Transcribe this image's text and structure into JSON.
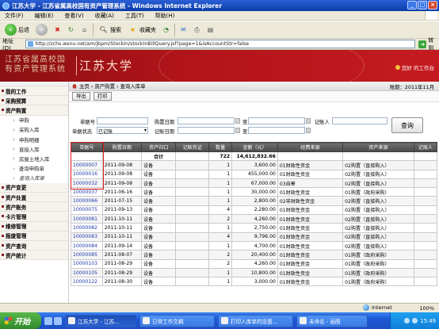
{
  "window": {
    "title": "江苏大学 - 江苏省属高校国有资产管理系统 - Windows Internet Explorer"
  },
  "menu": [
    "文件(F)",
    "编辑(E)",
    "查看(V)",
    "收藏(A)",
    "工具(T)",
    "帮助(H)"
  ],
  "toolbar": {
    "back": "后退",
    "search": "搜索",
    "favorites": "收藏夹"
  },
  "address": {
    "label": "地址(D)",
    "url": "http://zchs.wsnu.net/am/jbpm/StockIn/stockInBillQuery.jsf?page=1&isAccountStr=false",
    "go": "转到"
  },
  "banner": {
    "system_title_line1": "江苏省属高校国",
    "system_title_line2": "有资产管理系统",
    "university": "江苏大学",
    "user_text": "您好 的工作台"
  },
  "breadcrumb": {
    "text": "主页 › 资产购置 › 查询入库单",
    "period": "账期：2011年11月"
  },
  "actions": {
    "export": "导出",
    "print": "打印"
  },
  "filters": {
    "bill_no_label": "单据号",
    "buy_date_label": "购置日期",
    "to_label": "至",
    "bookkeeper_label": "记账人",
    "status_label": "单据状态",
    "status_value": "已记账",
    "record_date_label": "记账日期",
    "to_label2": "至",
    "query": "查询"
  },
  "nav": [
    {
      "label": "我的工作",
      "type": "section"
    },
    {
      "label": "采购预算",
      "type": "section"
    },
    {
      "label": "资产购置",
      "type": "section"
    },
    {
      "label": "申购",
      "type": "sub"
    },
    {
      "label": "采购入库",
      "type": "sub"
    },
    {
      "label": "申购明细",
      "type": "sub"
    },
    {
      "label": "直接入库",
      "type": "sub"
    },
    {
      "label": "房屋土地入库",
      "type": "sub"
    },
    {
      "label": "查询申购单",
      "type": "sub"
    },
    {
      "label": "查询入库单",
      "type": "sub-active"
    },
    {
      "label": "资产变更",
      "type": "section"
    },
    {
      "label": "资产处置",
      "type": "section"
    },
    {
      "label": "资产账务",
      "type": "section"
    },
    {
      "label": "卡片管理",
      "type": "section"
    },
    {
      "label": "维修管理",
      "type": "section"
    },
    {
      "label": "报废管理",
      "type": "section"
    },
    {
      "label": "资产查询",
      "type": "section"
    },
    {
      "label": "资产统计",
      "type": "section"
    }
  ],
  "table": {
    "headers": [
      "单据号",
      "购置日期",
      "资产归口",
      "记账凭证",
      "数量",
      "金额（元）",
      "经费来源",
      "资产来源",
      "记账人"
    ],
    "total": {
      "label": "合计",
      "qty": "722",
      "amount": "14,612,832.66"
    },
    "rows": [
      [
        "10000007",
        "2011-09-08",
        "设备",
        "",
        "1",
        "3,600.00",
        "01财政性资金",
        "02购置（直接购入）",
        ""
      ],
      [
        "10000016",
        "2011-09-08",
        "设备",
        "",
        "1",
        "455,000.00",
        "01财政性资金",
        "02购置（直接购入）",
        ""
      ],
      [
        "10000032",
        "2011-09-08",
        "设备",
        "",
        "1",
        "67,000.00",
        "03自筹",
        "02购置（直接购入）",
        ""
      ],
      [
        "10000037",
        "2011-06-16",
        "设备",
        "",
        "1",
        "30,000.00",
        "01财政性资金",
        "01购置（政府采购）",
        ""
      ],
      [
        "10000066",
        "2011-07-15",
        "设备",
        "",
        "1",
        "2,800.00",
        "02非财政性资金",
        "02购置（直接购入）",
        ""
      ],
      [
        "10000075",
        "2011-09-13",
        "设备",
        "",
        "4",
        "2,280.00",
        "01财政性资金",
        "02购置（直接购入）",
        ""
      ],
      [
        "10000081",
        "2011-10-11",
        "设备",
        "",
        "2",
        "4,260.00",
        "01财政性资金",
        "02购置（直接购入）",
        ""
      ],
      [
        "10000082",
        "2011-10-11",
        "设备",
        "",
        "1",
        "2,750.00",
        "01财政性资金",
        "02购置（直接购入）",
        ""
      ],
      [
        "10000083",
        "2011-10-11",
        "设备",
        "",
        "4",
        "9,796.00",
        "01财政性资金",
        "02购置（直接购入）",
        ""
      ],
      [
        "10000084",
        "2011-09-14",
        "设备",
        "",
        "1",
        "4,700.00",
        "01财政性资金",
        "02购置（直接购入）",
        ""
      ],
      [
        "10000085",
        "2011-08-07",
        "设备",
        "",
        "2",
        "20,400.00",
        "01财政性资金",
        "01购置（政府采购）",
        ""
      ],
      [
        "10000103",
        "2011-08-29",
        "设备",
        "",
        "2",
        "4,260.00",
        "01财政性资金",
        "01购置（政府采购）",
        ""
      ],
      [
        "10000105",
        "2011-08-29",
        "设备",
        "",
        "1",
        "10,800.00",
        "01财政性资金",
        "01购置（政府采购）",
        ""
      ],
      [
        "10000122",
        "2011-08-30",
        "设备",
        "",
        "1",
        "3,000.00",
        "01财政性资金",
        "01购置（政府采购）",
        ""
      ]
    ]
  },
  "status": {
    "zone": "Internet",
    "zoom": "100%"
  },
  "taskbar": {
    "start": "开始",
    "tasks": [
      "江苏大学 - 江苏...",
      "日常工作文稿",
      "打印入库单的设置...",
      "未命名 - 画图"
    ],
    "clock": "15:49"
  }
}
